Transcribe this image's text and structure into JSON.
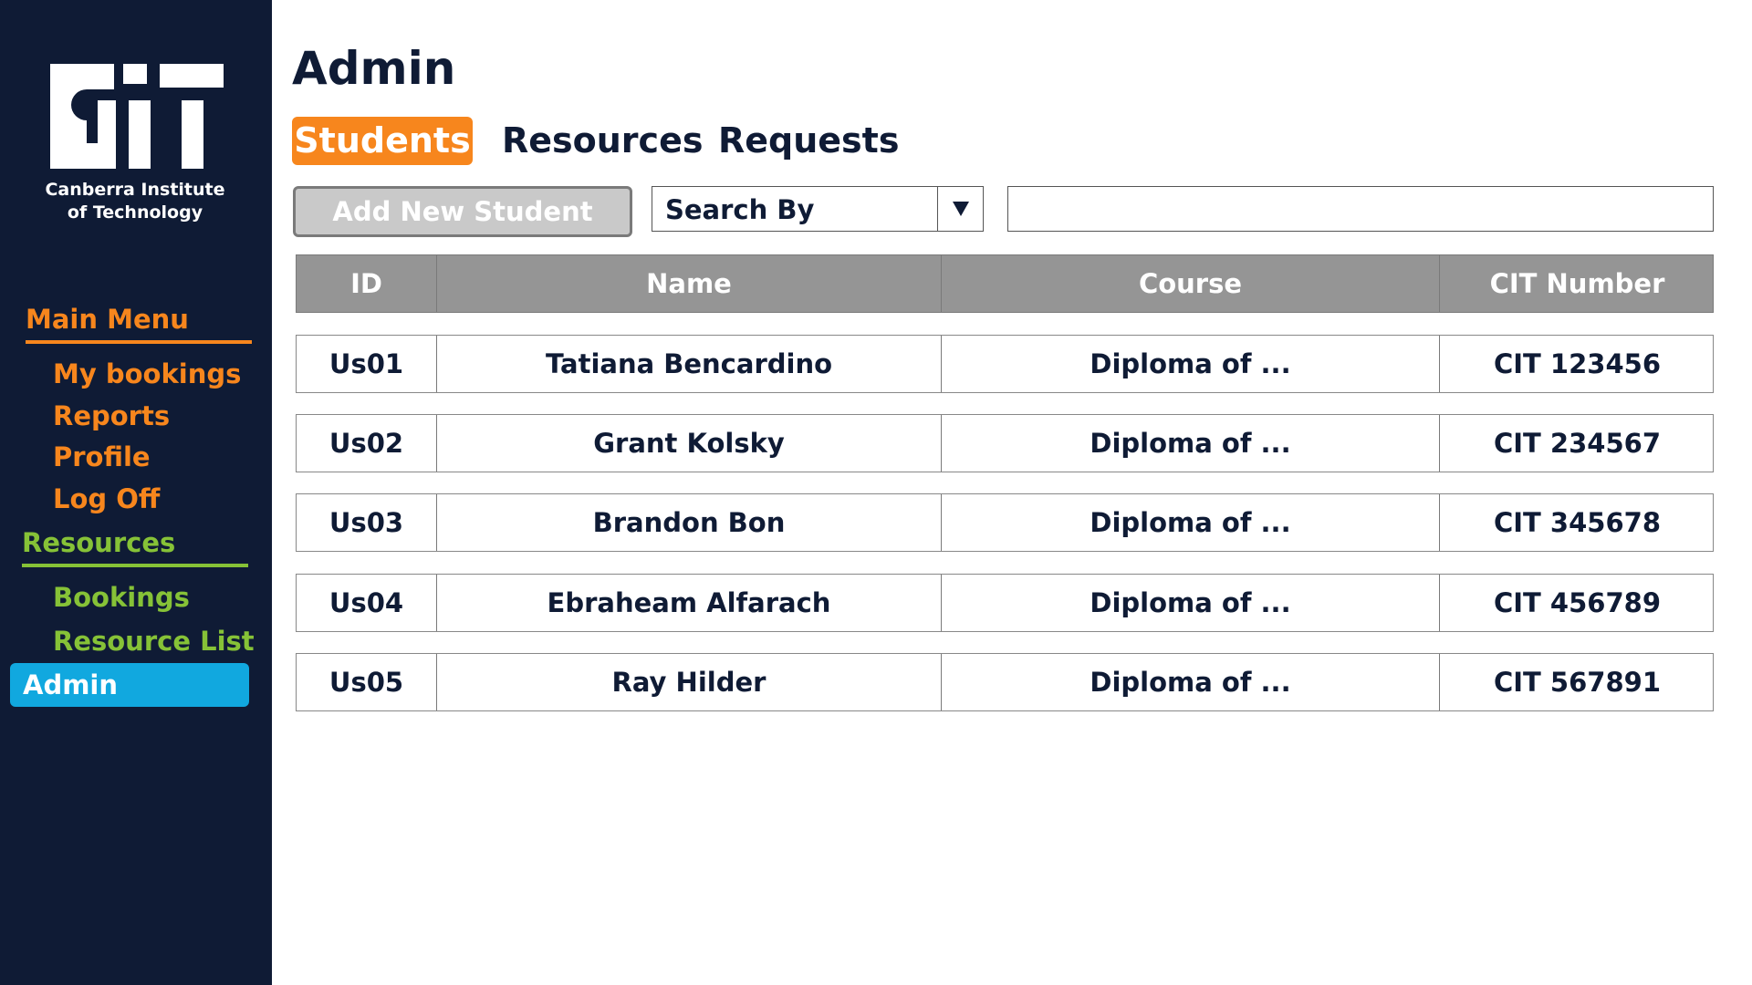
{
  "sidebar": {
    "logo_text_line1": "Canberra Institute",
    "logo_text_line2": "of Technology",
    "main_menu": {
      "header": "Main Menu",
      "items": [
        "My bookings",
        "Reports",
        "Profile",
        "Log Off"
      ]
    },
    "resources": {
      "header": "Resources",
      "items": [
        "Bookings",
        "Resource List"
      ]
    },
    "active_item": "Admin"
  },
  "main": {
    "title": "Admin",
    "tabs": [
      {
        "label": "Students",
        "active": true
      },
      {
        "label": "Resources",
        "active": false
      },
      {
        "label": "Requests",
        "active": false
      }
    ],
    "add_button_label": "Add New Student",
    "search_by": {
      "selected": "Search By"
    },
    "search_input": {
      "value": "",
      "placeholder": ""
    },
    "table": {
      "columns": [
        "ID",
        "Name",
        "Course",
        "CIT Number"
      ],
      "rows": [
        {
          "id": "Us01",
          "name": "Tatiana Bencardino",
          "course": "Diploma of ...",
          "cit": "CIT 123456"
        },
        {
          "id": "Us02",
          "name": "Grant Kolsky",
          "course": "Diploma of ...",
          "cit": "CIT 234567"
        },
        {
          "id": "Us03",
          "name": "Brandon Bon",
          "course": "Diploma of ...",
          "cit": "CIT 345678"
        },
        {
          "id": "Us04",
          "name": "Ebraheam Alfarach",
          "course": "Diploma of ...",
          "cit": "CIT 456789"
        },
        {
          "id": "Us05",
          "name": "Ray Hilder",
          "course": "Diploma of ...",
          "cit": "CIT 567891"
        }
      ]
    }
  },
  "colors": {
    "sidebar_bg": "#0f1b35",
    "accent_orange": "#f7861d",
    "accent_green": "#86c237",
    "active_blue": "#11a8df",
    "header_gray": "#959595"
  }
}
